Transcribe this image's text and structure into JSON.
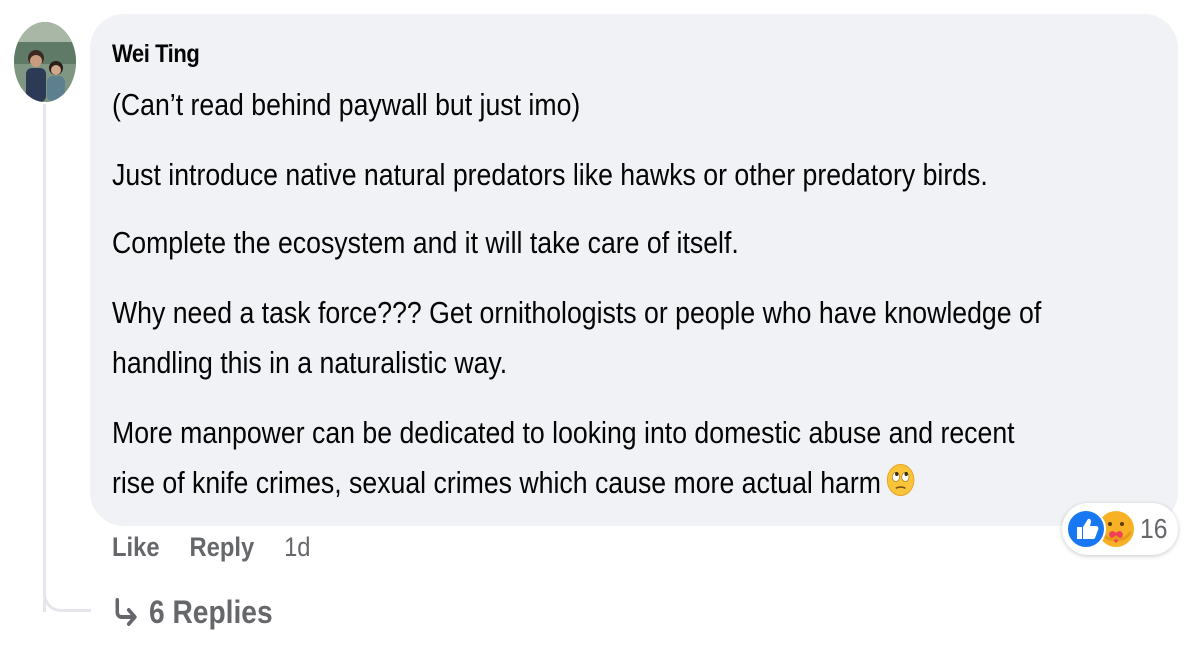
{
  "comment": {
    "author": "Wei Ting",
    "paragraphs": {
      "p1": "(Can’t read behind paywall but just imo)",
      "p2": "Just introduce native natural predators like hawks or other predatory birds.",
      "p3": "Complete the ecosystem and it will take care of itself.",
      "p4_line1": "Why need a task force??? Get ornithologists or people who have knowledge of",
      "p4_line2": "handling this in a naturalistic way.",
      "p5_line1": "More manpower can be dedicated to looking into domestic abuse and recent",
      "p5_line2": "rise of knife crimes, sexual crimes which cause more actual harm"
    },
    "emoji": "face-with-rolling-eyes-icon"
  },
  "reactions": {
    "icons": [
      "like-icon",
      "care-icon"
    ],
    "count": "16"
  },
  "actions": {
    "like_label": "Like",
    "reply_label": "Reply",
    "timestamp": "1d"
  },
  "replies": {
    "label": "6 Replies"
  },
  "colors": {
    "bubble": "#f0f2f5",
    "secondary_text": "#65676b",
    "like_blue": "#1877f2",
    "care_yellow": "#f7b125",
    "thread_line": "#e4e6eb"
  }
}
